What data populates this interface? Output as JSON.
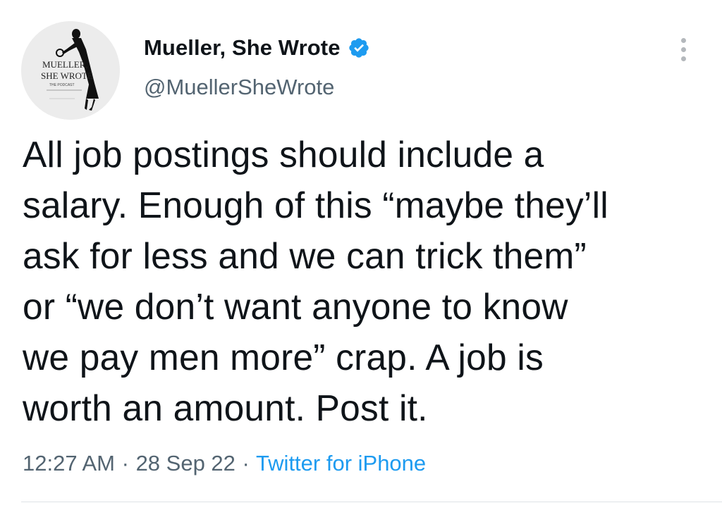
{
  "author": {
    "display_name": "Mueller, She Wrote",
    "handle": "@MuellerSheWrote",
    "verified": true,
    "avatar_lines": [
      "MUELLER,",
      "SHE WROTE",
      "THE PODCAST"
    ]
  },
  "tweet": {
    "lines": [
      "All job postings should include a",
      "salary. Enough of this “maybe they’ll",
      "ask for less and we can trick them”",
      "or “we don’t want anyone to know",
      "we pay men more” crap. A job is",
      "worth an amount. Post it."
    ]
  },
  "meta": {
    "time": "12:27 AM",
    "separator": "·",
    "date": "28 Sep 22",
    "source": "Twitter for iPhone"
  },
  "colors": {
    "text": "#0f1419",
    "secondary": "#536471",
    "link": "#1d9bf0",
    "verified_badge": "#1d9bf0"
  },
  "icons": {
    "verified": "verified-badge-icon",
    "more": "more-options-icon"
  }
}
